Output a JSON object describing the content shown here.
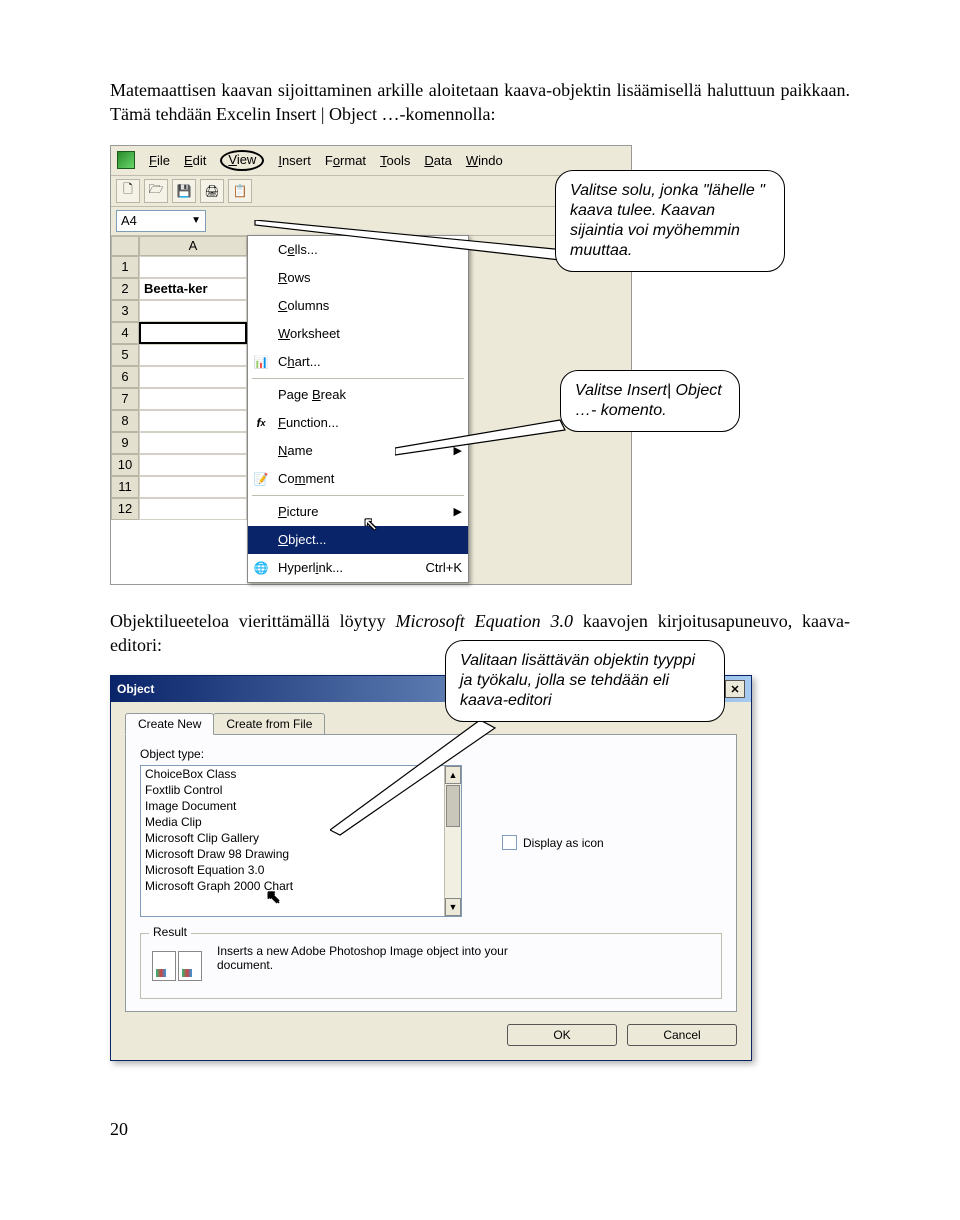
{
  "para1": "Matemaattisen kaavan sijoittaminen arkille aloitetaan kaava-objektin lisäämisellä haluttuun paikkaan. Tämä tehdään Excelin Insert | Object …-komennolla:",
  "para2_a": "Objektilueeteloa vierittämällä löytyy ",
  "para2_em": "Microsoft Equation 3.0",
  "para2_b": "  kaavojen kirjoitusapuneuvo, kaava-editori:",
  "page_number": "20",
  "callout1": "Valitse solu, jonka \"lähelle \" kaava tulee. Kaavan sijaintia voi myöhemmin muuttaa.",
  "callout2": "Valitse Insert| Object …- komento.",
  "callout3": "Valitaan lisättävän objektin tyyppi ja työkalu, jolla se tehdään eli kaava-editori",
  "excel": {
    "menus": [
      "File",
      "Edit",
      "View",
      "Insert",
      "Format",
      "Tools",
      "Data",
      "Window"
    ],
    "toolbar_icons": [
      "🗋",
      "🗁",
      "💾",
      "🖨",
      "📋"
    ],
    "namebox": "A4",
    "col_header": "A",
    "rows": [
      "1",
      "2",
      "3",
      "4",
      "5",
      "6",
      "7",
      "8",
      "9",
      "10",
      "11",
      "12"
    ],
    "cell_a2": "Beetta-ker",
    "menu_items": [
      {
        "label": "Cells...",
        "icon": ""
      },
      {
        "label": "Rows",
        "icon": ""
      },
      {
        "label": "Columns",
        "icon": ""
      },
      {
        "label": "Worksheet",
        "icon": ""
      },
      {
        "label": "Chart...",
        "icon": "📊"
      },
      {
        "sep": true
      },
      {
        "label": "Page Break",
        "icon": ""
      },
      {
        "label": "Function...",
        "icon": "fx"
      },
      {
        "label": "Name",
        "icon": "",
        "sub": true
      },
      {
        "label": "Comment",
        "icon": "📝"
      },
      {
        "sep": true
      },
      {
        "label": "Picture",
        "icon": "",
        "sub": true
      },
      {
        "label": "Object...",
        "icon": "",
        "selected": true
      },
      {
        "label": "Hyperlink...",
        "icon": "🌐",
        "shortcut": "Ctrl+K"
      }
    ]
  },
  "dialog": {
    "title": "Object",
    "tab1": "Create New",
    "tab2": "Create from File",
    "object_type_label": "Object type:",
    "list": [
      "ChoiceBox Class",
      "Foxtlib Control",
      "Image Document",
      "Media Clip",
      "Microsoft Clip Gallery",
      "Microsoft Draw 98 Drawing",
      "Microsoft Equation 3.0",
      "Microsoft Graph 2000 Chart"
    ],
    "display_as_icon": "Display as icon",
    "result_legend": "Result",
    "result_text": "Inserts a new Adobe Photoshop Image object into your document.",
    "ok": "OK",
    "cancel": "Cancel"
  }
}
